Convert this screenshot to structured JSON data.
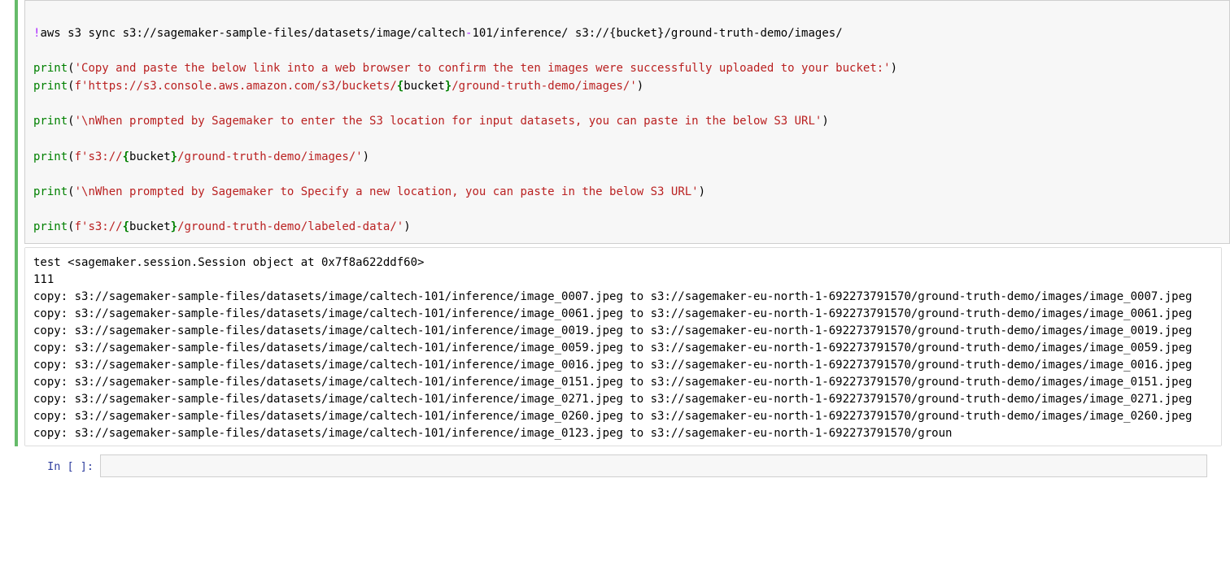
{
  "code_cell": {
    "line1": {
      "bang": "!",
      "text": "aws s3 sync s3://sagemaker-sample-files/datasets/image/caltech",
      "dash": "-",
      "text2": "101/inference/ s3://{bucket}/ground-truth-demo/images/"
    },
    "line2": {
      "fn": "print",
      "open": "(",
      "str": "'Copy and paste the below link into a web browser to confirm the ten images were successfully uploaded to your bucket:'",
      "close": ")"
    },
    "line3": {
      "fn": "print",
      "open": "(",
      "prefix": "f'https://s3.console.aws.amazon.com/s3/buckets/",
      "brace_open": "{",
      "var": "bucket",
      "brace_close": "}",
      "suffix": "/ground-truth-demo/images/'",
      "close": ")"
    },
    "line4": {
      "fn": "print",
      "open": "(",
      "str": "'\\nWhen prompted by Sagemaker to enter the S3 location for input datasets, you can paste in the below S3 URL'",
      "close": ")"
    },
    "line5": {
      "fn": "print",
      "open": "(",
      "prefix": "f's3://",
      "brace_open": "{",
      "var": "bucket",
      "brace_close": "}",
      "suffix": "/ground-truth-demo/images/'",
      "close": ")"
    },
    "line6": {
      "fn": "print",
      "open": "(",
      "str": "'\\nWhen prompted by Sagemaker to Specify a new location, you can paste in the below S3 URL'",
      "close": ")"
    },
    "line7": {
      "fn": "print",
      "open": "(",
      "prefix": "f's3://",
      "brace_open": "{",
      "var": "bucket",
      "brace_close": "}",
      "suffix": "/ground-truth-demo/labeled-data/'",
      "close": ")"
    }
  },
  "output": {
    "lines": [
      "test <sagemaker.session.Session object at 0x7f8a622ddf60>",
      "111",
      "copy: s3://sagemaker-sample-files/datasets/image/caltech-101/inference/image_0007.jpeg to s3://sagemaker-eu-north-1-692273791570/ground-truth-demo/images/image_0007.jpeg",
      "copy: s3://sagemaker-sample-files/datasets/image/caltech-101/inference/image_0061.jpeg to s3://sagemaker-eu-north-1-692273791570/ground-truth-demo/images/image_0061.jpeg",
      "copy: s3://sagemaker-sample-files/datasets/image/caltech-101/inference/image_0019.jpeg to s3://sagemaker-eu-north-1-692273791570/ground-truth-demo/images/image_0019.jpeg",
      "copy: s3://sagemaker-sample-files/datasets/image/caltech-101/inference/image_0059.jpeg to s3://sagemaker-eu-north-1-692273791570/ground-truth-demo/images/image_0059.jpeg",
      "copy: s3://sagemaker-sample-files/datasets/image/caltech-101/inference/image_0016.jpeg to s3://sagemaker-eu-north-1-692273791570/ground-truth-demo/images/image_0016.jpeg",
      "copy: s3://sagemaker-sample-files/datasets/image/caltech-101/inference/image_0151.jpeg to s3://sagemaker-eu-north-1-692273791570/ground-truth-demo/images/image_0151.jpeg",
      "copy: s3://sagemaker-sample-files/datasets/image/caltech-101/inference/image_0271.jpeg to s3://sagemaker-eu-north-1-692273791570/ground-truth-demo/images/image_0271.jpeg",
      "copy: s3://sagemaker-sample-files/datasets/image/caltech-101/inference/image_0260.jpeg to s3://sagemaker-eu-north-1-692273791570/ground-truth-demo/images/image_0260.jpeg",
      "copy: s3://sagemaker-sample-files/datasets/image/caltech-101/inference/image_0123.jpeg to s3://sagemaker-eu-north-1-692273791570/groun"
    ]
  },
  "empty_prompt": "In [ ]:"
}
